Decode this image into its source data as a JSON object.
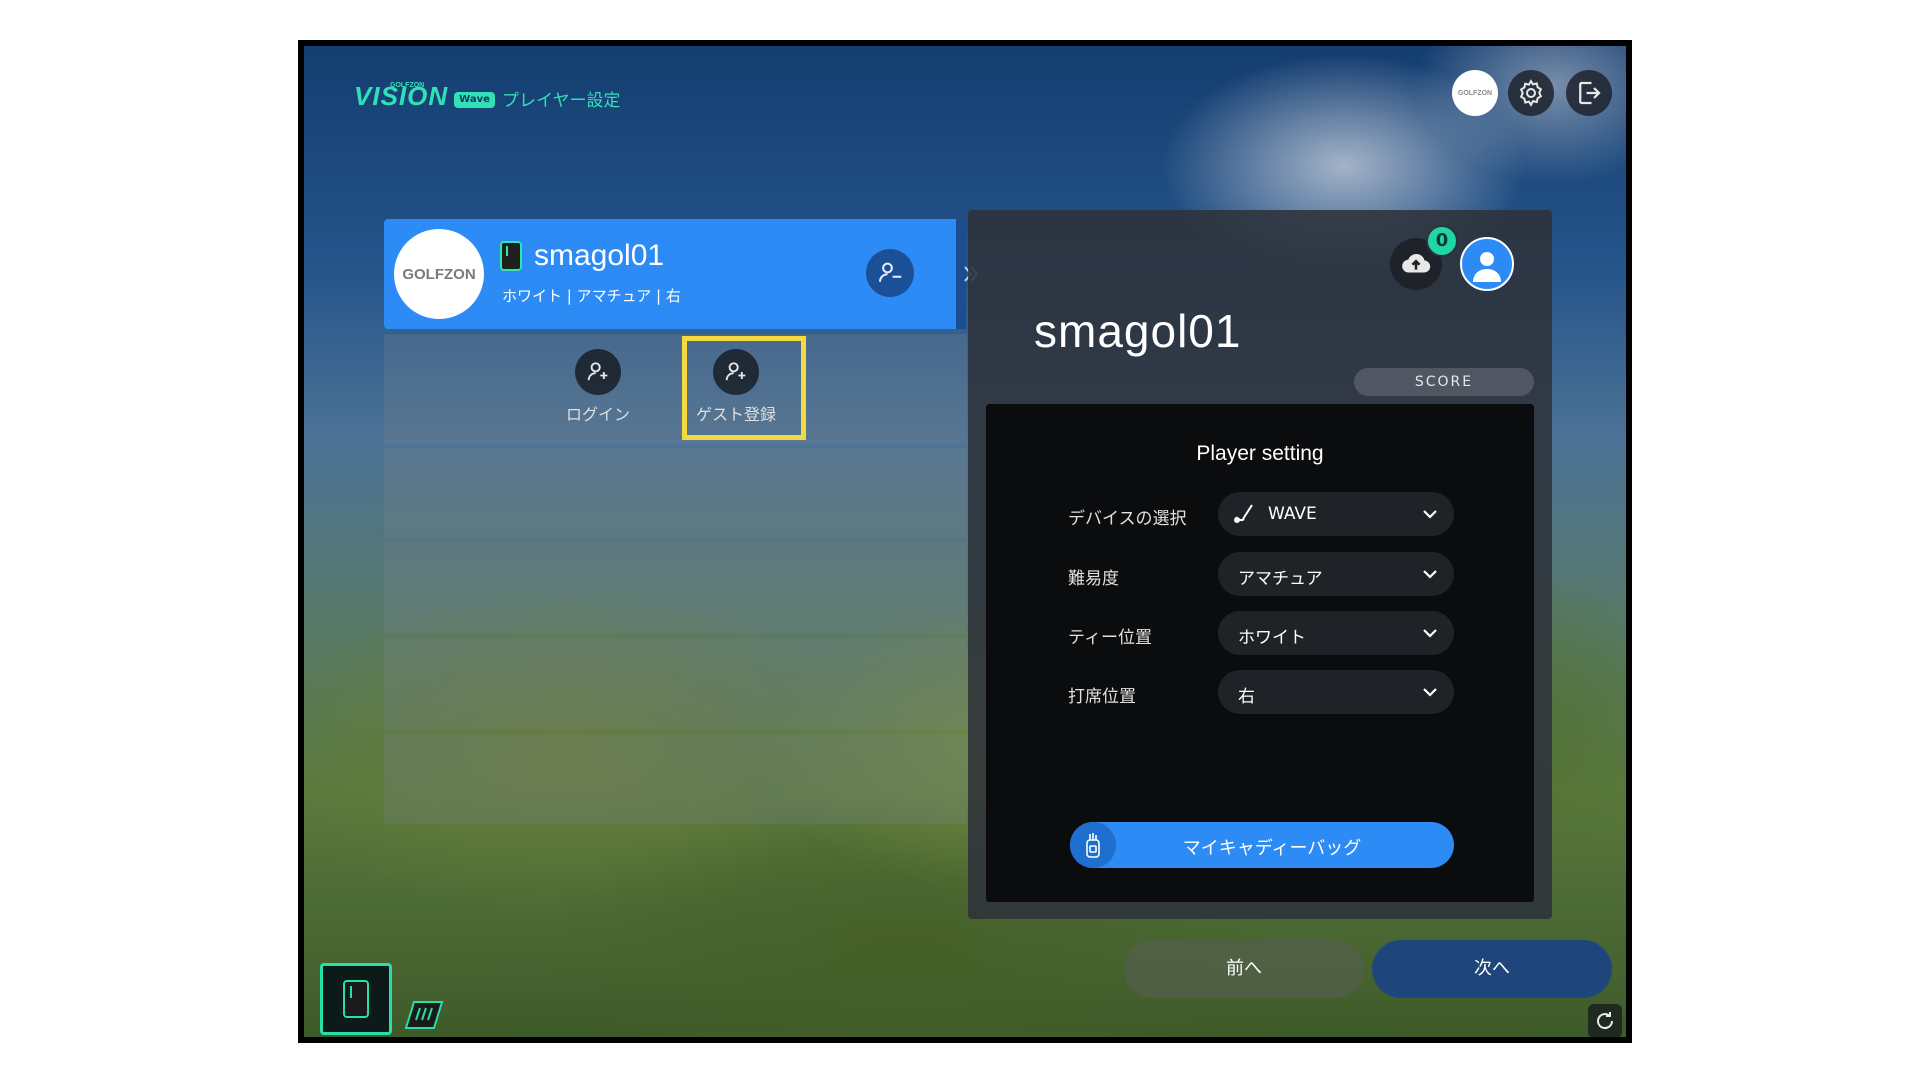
{
  "header": {
    "brand_small": "GOLFZON",
    "brand": "VISION",
    "brand_badge": "Wave",
    "title": "プレイヤー設定",
    "logo_text": "GOLFZON",
    "gear_icon": "gear-icon",
    "exit_icon": "logout-icon"
  },
  "player": {
    "avatar_text": "GOLFZON",
    "name": "smagol01",
    "info": "ホワイト | アマチュア | 右",
    "device_icon": "phone-icon",
    "remove_icon": "remove-user-icon",
    "expand_icon": "chevron-right-icon"
  },
  "actions": {
    "login": "ログイン",
    "guest": "ゲスト登録"
  },
  "panel": {
    "name": "smagol01",
    "upload_count": "0",
    "score_label": "SCORE",
    "settings_title": "Player setting",
    "rows": [
      {
        "label": "デバイスの選択",
        "value": "WAVE",
        "icon": "club-icon"
      },
      {
        "label": "難易度",
        "value": "アマチュア"
      },
      {
        "label": "ティー位置",
        "value": "ホワイト"
      },
      {
        "label": "打席位置",
        "value": "右"
      }
    ],
    "bag_button": "マイキャディーバッグ"
  },
  "footer": {
    "prev": "前へ",
    "next": "次へ"
  },
  "colors": {
    "accent": "#2d8bf5",
    "teal": "#32e0b8",
    "highlight": "#f4d940"
  }
}
